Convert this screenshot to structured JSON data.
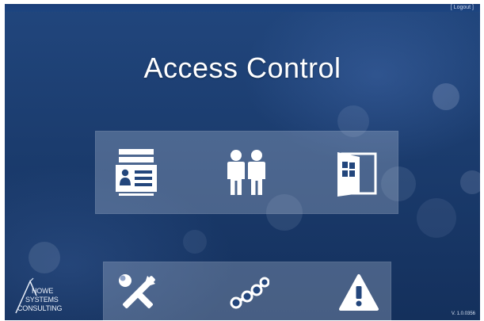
{
  "header": {
    "logout_label": "[ Logout ]"
  },
  "title": "Access Control",
  "tiles_top": [
    {
      "icon": "id-card-stack-icon"
    },
    {
      "icon": "people-icon"
    },
    {
      "icon": "door-icon"
    }
  ],
  "tiles_bottom": [
    {
      "icon": "tools-icon"
    },
    {
      "icon": "connections-icon"
    },
    {
      "icon": "warning-icon"
    }
  ],
  "brand": {
    "line1": "HOWE",
    "line2": "SYSTEMS",
    "line3": "CONSULTING"
  },
  "version": "V. 1.0.0356",
  "colors": {
    "background": "#1b3c6e",
    "panel": "#8fa3c8",
    "icon": "#ffffff"
  }
}
